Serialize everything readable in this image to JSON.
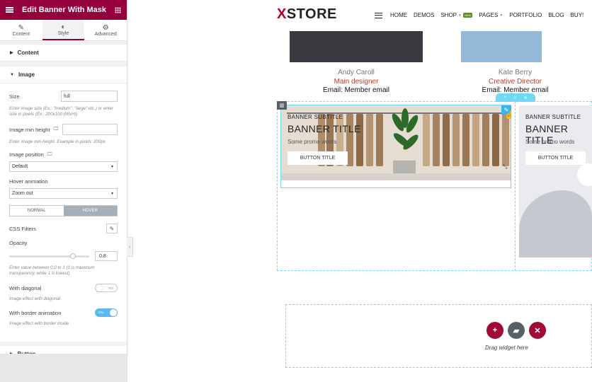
{
  "panel": {
    "title": "Edit Banner With Mask",
    "tabs": [
      {
        "label": "Content",
        "icon": "pencil-icon"
      },
      {
        "label": "Style",
        "icon": "contrast-icon"
      },
      {
        "label": "Advanced",
        "icon": "gear-icon"
      }
    ],
    "sections": {
      "content": "Content",
      "image": "Image",
      "button": "Button"
    },
    "image": {
      "size_label": "Size",
      "size_value": "full",
      "size_help": "Enter image size (Ex.: \"medium\", \"large\" etc.) or enter size in pixels (Ex.: 200x100 (WxH))",
      "min_height_label": "Image min height",
      "min_height_value": "",
      "min_height_help": "Enter image min-height. Example in pixels: 200px",
      "position_label": "Image position",
      "position_value": "Default",
      "hover_anim_label": "Hover animation",
      "hover_anim_value": "Zoom out",
      "state_normal": "NORMAL",
      "state_hover": "HOVER",
      "css_filters_label": "CSS Filters",
      "opacity_label": "Opacity",
      "opacity_value": "0.8",
      "opacity_help": "Enter value between 0.0 to 1 (0 is maximum transparency, while 1 is lowest)",
      "diagonal_label": "With diagonal",
      "diagonal_toggle": "NO",
      "diagonal_help": "Image effect with diagonal",
      "border_anim_label": "With border animation",
      "border_anim_toggle": "ON",
      "border_anim_help": "Image effect with border inside"
    }
  },
  "site": {
    "logo_x": "X",
    "logo_rest": "STORE",
    "nav": [
      "HOME",
      "DEMOS",
      "SHOP",
      "PAGES",
      "PORTFOLIO",
      "BLOG",
      "BUY!"
    ],
    "nav_badge": "NEW"
  },
  "team": [
    {
      "name": "Andy Caroll",
      "role": "Main designer",
      "email": "Email: Member email"
    },
    {
      "name": "Kate Berry",
      "role": "Creative Director",
      "email": "Email: Member email"
    }
  ],
  "banners": [
    {
      "subtitle": "BANNER SUBTITLE",
      "title": "BANNER TITLE",
      "promo": "Some promo words",
      "button": "BUTTON TITLE"
    },
    {
      "subtitle": "BANNER SUBTITLE",
      "title": "BANNER TITLE",
      "promo": "Some promo words",
      "button": "BUTTON TITLE"
    }
  ],
  "drop_zone": {
    "text": "Drag widget here"
  },
  "colors": {
    "brand": "#93003c",
    "accent": "#71d7f7",
    "toggle_on": "#5bb9f0"
  }
}
